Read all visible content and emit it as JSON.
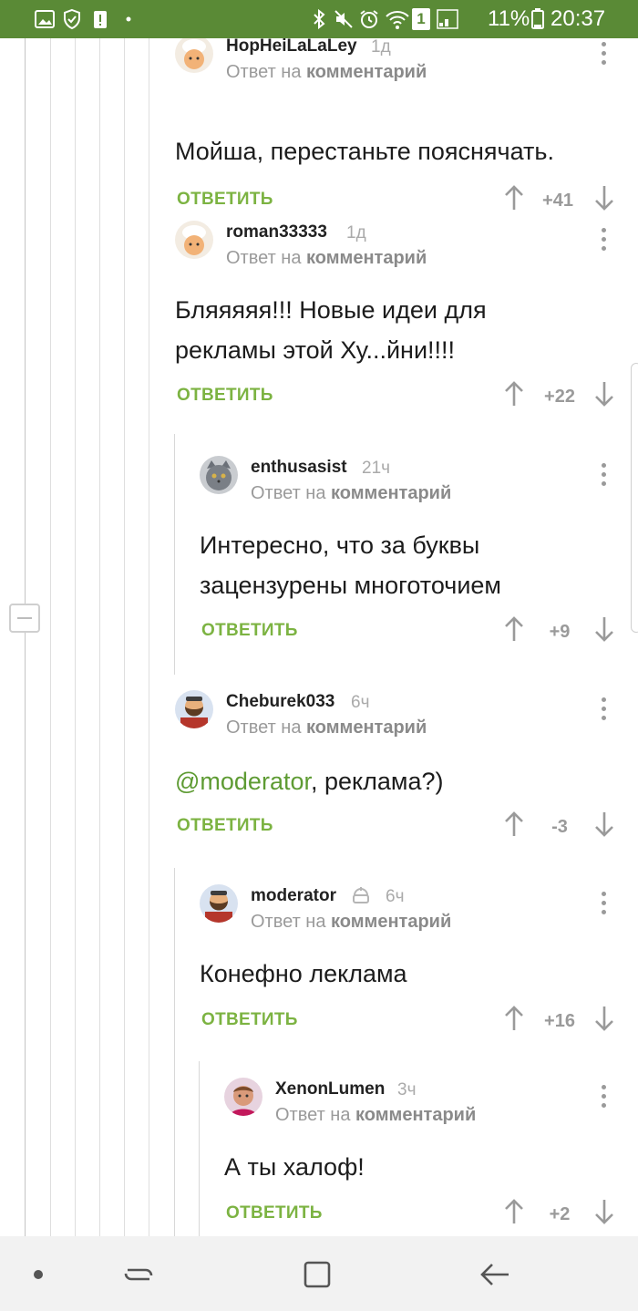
{
  "status_bar": {
    "battery_percent": "11%",
    "time": "20:37",
    "sim_label": "1",
    "icons": [
      "image-icon",
      "shield-icon",
      "alert-icon",
      "dot-icon",
      "bluetooth-icon",
      "mute-icon",
      "alarm-icon",
      "wifi-icon",
      "sim-icon",
      "signal-icon",
      "battery-icon"
    ]
  },
  "comments": [
    {
      "username": "HopHeiLaLaLey",
      "time": "1д",
      "reply_prefix": "Ответ на",
      "reply_target": "комментарий",
      "lines": [
        "Мойша, перестаньте пояснячать."
      ],
      "reply_label": "ОТВЕТИТЬ",
      "score": "+41",
      "avatar": "chef-avatar"
    },
    {
      "username": "roman33333",
      "time": "1д",
      "reply_prefix": "Ответ на",
      "reply_target": "комментарий",
      "lines": [
        "Бляяяяя!!! Новые идеи для",
        "рекламы этой Ху...йни!!!!"
      ],
      "reply_label": "ОТВЕТИТЬ",
      "score": "+22",
      "avatar": "chef-avatar"
    },
    {
      "username": "enthusasist",
      "time": "21ч",
      "reply_prefix": "Ответ на",
      "reply_target": "комментарий",
      "lines": [
        "Интересно, что за буквы",
        "зацензурены многоточием"
      ],
      "reply_label": "ОТВЕТИТЬ",
      "score": "+9",
      "avatar": "cat-avatar"
    },
    {
      "username": "Cheburek033",
      "time": "6ч",
      "reply_prefix": "Ответ на",
      "reply_target": "комментарий",
      "mention": "@moderator",
      "text_after_mention": ", реклама?)",
      "reply_label": "ОТВЕТИТЬ",
      "score": "-3",
      "avatar": "bearded-man-avatar"
    },
    {
      "username": "moderator",
      "time": "6ч",
      "reply_prefix": "Ответ на",
      "reply_target": "комментарий",
      "lines": [
        "Конефно леклама"
      ],
      "reply_label": "ОТВЕТИТЬ",
      "score": "+16",
      "avatar": "bearded-man-avatar",
      "badge_icon": "moderator-badge-icon"
    },
    {
      "username": "XenonLumen",
      "time": "3ч",
      "reply_prefix": "Ответ на",
      "reply_target": "комментарий",
      "lines": [
        "А ты халоф!"
      ],
      "reply_label": "ОТВЕТИТЬ",
      "score": "+2",
      "avatar": "pink-avatar"
    }
  ],
  "nav_bar": {
    "icons": [
      "dot-icon",
      "recent-apps-icon",
      "home-icon",
      "back-icon"
    ]
  },
  "colors": {
    "status_bar": "#5a8a36",
    "reply_link": "#7cb342",
    "mention": "#5e9b33"
  }
}
